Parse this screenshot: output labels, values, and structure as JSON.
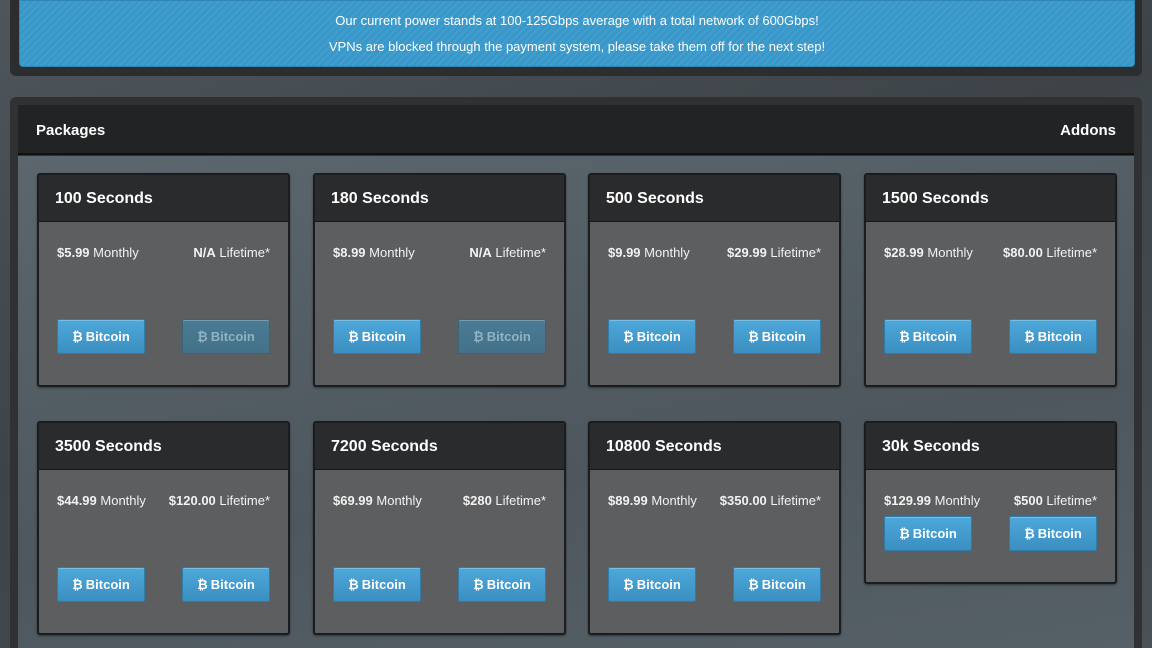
{
  "banner": {
    "line1": "Our current power stands at 100-125Gbps average with a total network of 600Gbps!",
    "line2": "VPNs are blocked through the payment system, please take them off for the next step!"
  },
  "panel": {
    "title": "Packages",
    "addons": "Addons"
  },
  "button_icon": "₿",
  "button_label": "Bitcoin",
  "lifetime_suffix": "Lifetime*",
  "monthly_suffix": "Monthly",
  "packages": [
    {
      "name": "100 Seconds",
      "monthly": "$5.99",
      "lifetime": "N/A",
      "lifetime_enabled": false
    },
    {
      "name": "180 Seconds",
      "monthly": "$8.99",
      "lifetime": "N/A",
      "lifetime_enabled": false
    },
    {
      "name": "500 Seconds",
      "monthly": "$9.99",
      "lifetime": "$29.99",
      "lifetime_enabled": true
    },
    {
      "name": "1500 Seconds",
      "monthly": "$28.99",
      "lifetime": "$80.00",
      "lifetime_enabled": true
    },
    {
      "name": "3500 Seconds",
      "monthly": "$44.99",
      "lifetime": "$120.00",
      "lifetime_enabled": true
    },
    {
      "name": "7200 Seconds",
      "monthly": "$69.99",
      "lifetime": "$280",
      "lifetime_enabled": true
    },
    {
      "name": "10800 Seconds",
      "monthly": "$89.99",
      "lifetime": "$350.00",
      "lifetime_enabled": true
    },
    {
      "name": "30k Seconds",
      "monthly": "$129.99",
      "lifetime": "$500",
      "lifetime_enabled": true
    }
  ],
  "colors": {
    "banner": "#3f9fd0",
    "button": "#4ea8da",
    "card": "#5d5e5f",
    "card_header": "#2a2b2c"
  }
}
